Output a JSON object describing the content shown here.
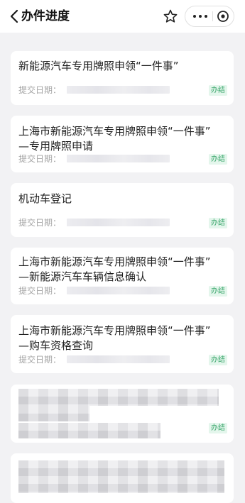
{
  "header": {
    "title": "办件进度"
  },
  "cards": [
    {
      "title": "新能源汽车专用牌照申领“一件事”",
      "date_label": "提交日期：",
      "status": "办结"
    },
    {
      "title": "上海市新能源汽车专用牌照申领“一件事”\n—专用牌照申请",
      "date_label": "提交日期：",
      "status": "办结"
    },
    {
      "title": "机动车登记",
      "date_label": "提交日期：",
      "status": "办结"
    },
    {
      "title": "上海市新能源汽车专用牌照申领“一件事”\n—新能源汽车车辆信息确认",
      "date_label": "提交日期：",
      "status": "办结"
    },
    {
      "title": "上海市新能源汽车专用牌照申领“一件事”\n—购车资格查询",
      "date_label": "提交日期：",
      "status": "办结"
    },
    {
      "status": "办结"
    }
  ],
  "colors": {
    "badge_text": "#3aa66b",
    "badge_bg": "#e4f6ec",
    "page_bg": "#f2f2f4"
  }
}
